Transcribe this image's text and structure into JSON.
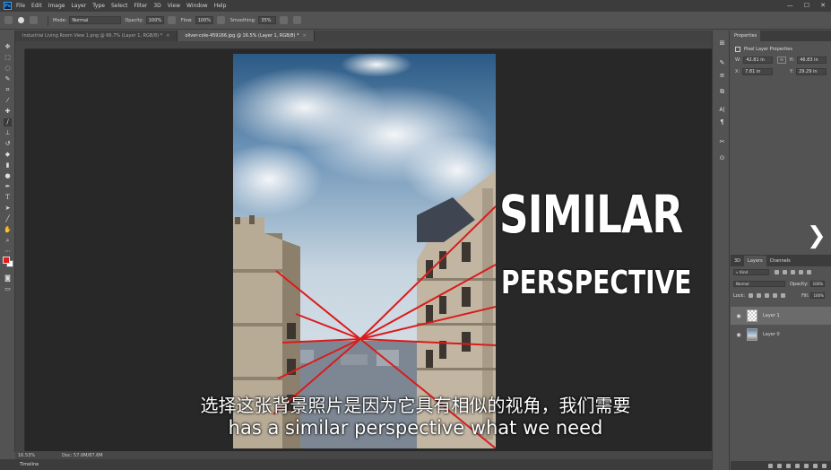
{
  "app": {
    "logo": "Ps"
  },
  "menu": [
    "File",
    "Edit",
    "Image",
    "Layer",
    "Type",
    "Select",
    "Filter",
    "3D",
    "View",
    "Window",
    "Help"
  ],
  "window_controls": [
    "—",
    "☐",
    "✕"
  ],
  "options": {
    "mode_label": "Mode:",
    "mode_value": "Normal",
    "opacity_label": "Opacity:",
    "opacity_value": "100%",
    "flow_label": "Flow:",
    "flow_value": "100%",
    "smoothing_label": "Smoothing:",
    "smoothing_value": "35%"
  },
  "tabs": [
    {
      "label": "Industrial Living Room View 1.png @ 66.7% (Layer 1, RGB/8) *",
      "active": false
    },
    {
      "label": "oliver-cole-459166.jpg @ 16.5% (Layer 1, RGB/8) *",
      "active": true
    }
  ],
  "canvas": {
    "title_line1": "SIMILAR",
    "title_line2": "PERSPECTIVE",
    "subtitle_cn": "选择这张背景照片是因为它具有相似的视角，我们需要",
    "subtitle_en": "has a similar perspective what we need"
  },
  "status": {
    "zoom": "16.53%",
    "doc": "Doc: 57.0M/87.6M"
  },
  "timeline": {
    "label": "Timeline"
  },
  "properties": {
    "tabs": [
      "Properties"
    ],
    "title": "Pixel Layer Properties",
    "w_label": "W:",
    "w_value": "42.81 in",
    "h_label": "H:",
    "h_value": "46.83 in",
    "x_label": "X:",
    "x_value": "7.81 in",
    "y_label": "Y:",
    "y_value": "29.29 in"
  },
  "layers": {
    "tabs": [
      "3D",
      "Layers",
      "Channels"
    ],
    "kind_label": "Kind",
    "blend_mode": "Normal",
    "opacity_label": "Opacity:",
    "opacity_value": "100%",
    "lock_label": "Lock:",
    "fill_label": "Fill:",
    "fill_value": "100%",
    "items": [
      {
        "name": "Layer 1",
        "selected": true
      },
      {
        "name": "Layer 0",
        "selected": false
      }
    ]
  },
  "colors": {
    "foreground": "#e41b17",
    "background": "#ffffff",
    "perspective_lines": "#d91c1c"
  },
  "nav": {
    "next_arrow": "❯"
  }
}
